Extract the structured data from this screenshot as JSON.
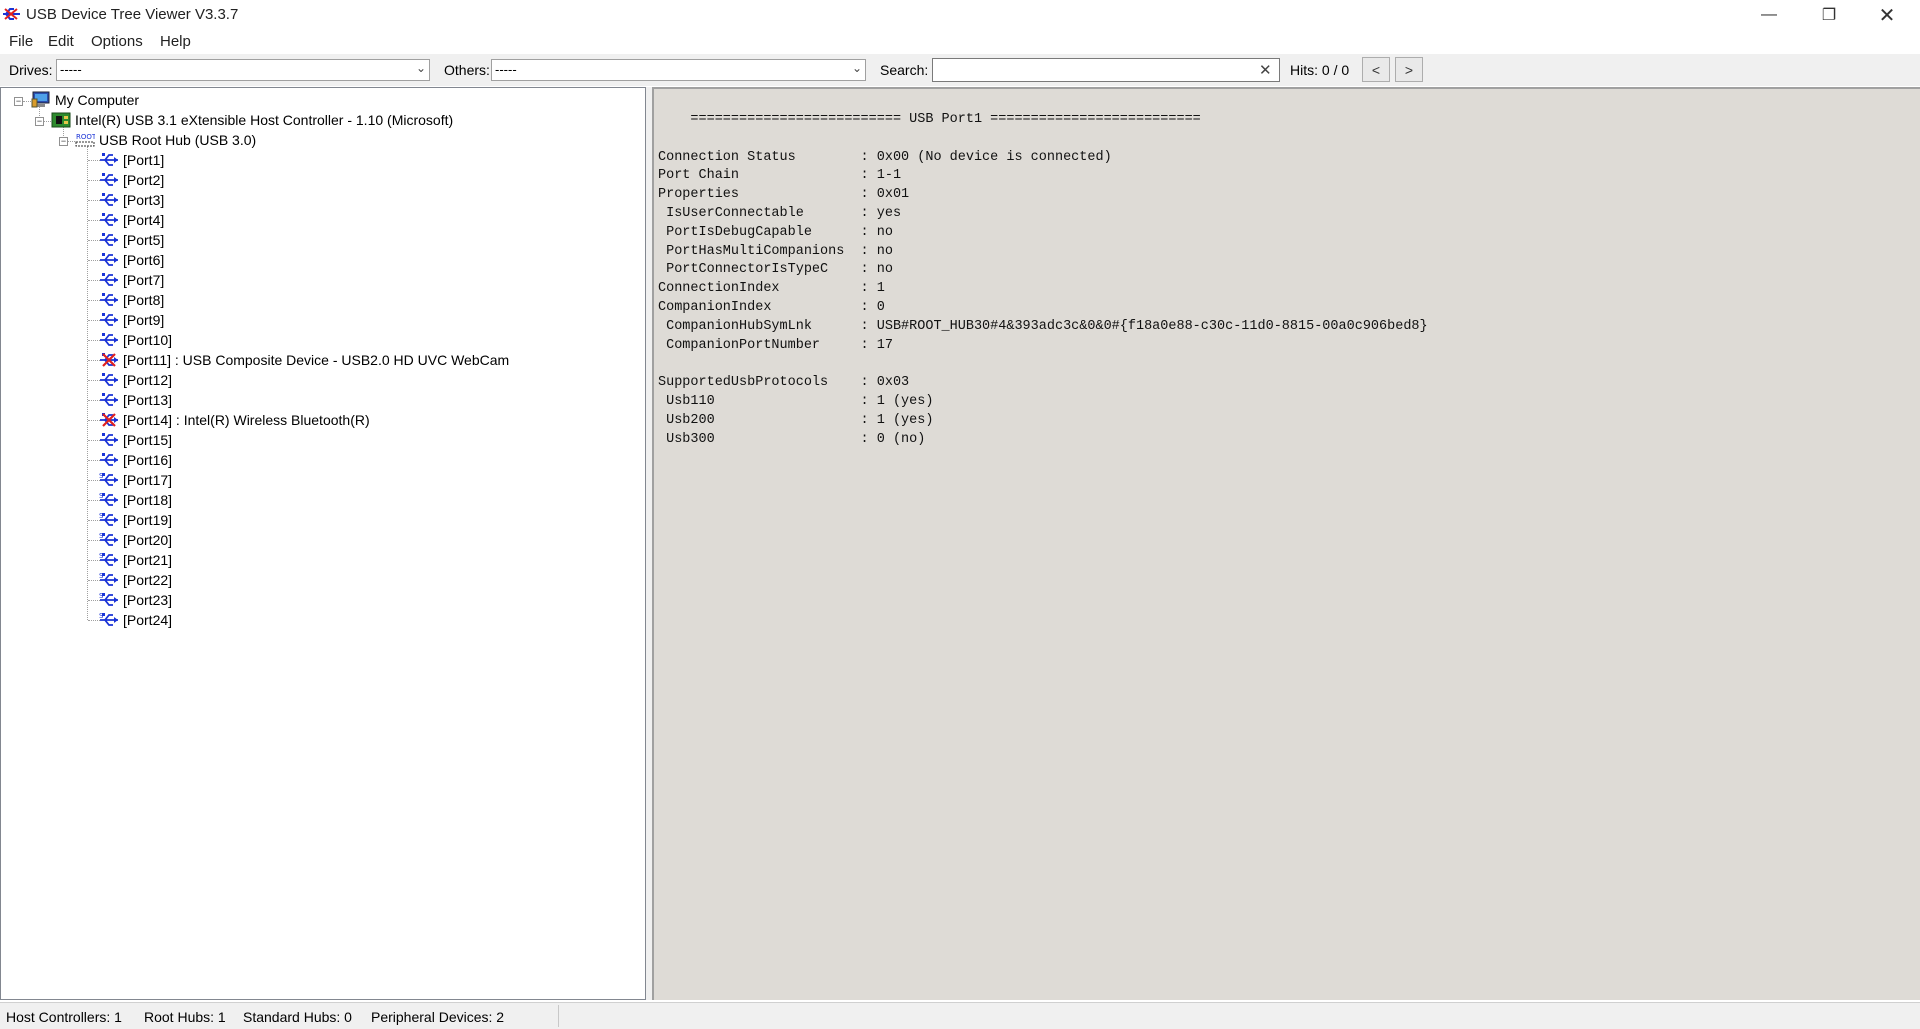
{
  "window": {
    "title": "USB Device Tree Viewer V3.3.7",
    "minimize_glyph": "—",
    "maximize_glyph": "❐",
    "close_glyph": "✕"
  },
  "menu": [
    "File",
    "Edit",
    "Options",
    "Help"
  ],
  "toolbar": {
    "drives_label": "Drives:",
    "drives_value": "-----",
    "others_label": "Others:",
    "others_value": "-----",
    "search_label": "Search:",
    "search_value": "",
    "hits_label": "Hits: 0 / 0",
    "prev_label": "<",
    "next_label": ">"
  },
  "tree": {
    "root": "My Computer",
    "controller": "Intel(R) USB 3.1 eXtensible Host Controller - 1.10 (Microsoft)",
    "hub_tag": "ROOT",
    "hub": "USB Root Hub (USB 3.0)",
    "ports": [
      {
        "label": "[Port1]",
        "status": "empty"
      },
      {
        "label": "[Port2]",
        "status": "empty"
      },
      {
        "label": "[Port3]",
        "status": "empty"
      },
      {
        "label": "[Port4]",
        "status": "empty"
      },
      {
        "label": "[Port5]",
        "status": "empty"
      },
      {
        "label": "[Port6]",
        "status": "empty"
      },
      {
        "label": "[Port7]",
        "status": "empty"
      },
      {
        "label": "[Port8]",
        "status": "empty"
      },
      {
        "label": "[Port9]",
        "status": "empty"
      },
      {
        "label": "[Port10]",
        "status": "empty"
      },
      {
        "label": "[Port11] : USB Composite Device - USB2.0 HD UVC WebCam",
        "status": "device"
      },
      {
        "label": "[Port12]",
        "status": "empty"
      },
      {
        "label": "[Port13]",
        "status": "empty"
      },
      {
        "label": "[Port14] : Intel(R) Wireless Bluetooth(R)",
        "status": "device"
      },
      {
        "label": "[Port15]",
        "status": "empty"
      },
      {
        "label": "[Port16]",
        "status": "empty"
      },
      {
        "label": "[Port17]",
        "status": "ss"
      },
      {
        "label": "[Port18]",
        "status": "ss"
      },
      {
        "label": "[Port19]",
        "status": "ss"
      },
      {
        "label": "[Port20]",
        "status": "ss"
      },
      {
        "label": "[Port21]",
        "status": "ss"
      },
      {
        "label": "[Port22]",
        "status": "ss"
      },
      {
        "label": "[Port23]",
        "status": "ss"
      },
      {
        "label": "[Port24]",
        "status": "ss"
      }
    ]
  },
  "detail": {
    "text": "    ========================== USB Port1 ==========================\n\nConnection Status        : 0x00 (No device is connected)\nPort Chain               : 1-1\nProperties               : 0x01\n IsUserConnectable       : yes\n PortIsDebugCapable      : no\n PortHasMultiCompanions  : no\n PortConnectorIsTypeC    : no\nConnectionIndex          : 1\nCompanionIndex           : 0\n CompanionHubSymLnk      : USB#ROOT_HUB30#4&393adc3c&0&0#{f18a0e88-c30c-11d0-8815-00a0c906bed8}\n CompanionPortNumber     : 17\n\nSupportedUsbProtocols    : 0x03\n Usb110                  : 1 (yes)\n Usb200                  : 1 (yes)\n Usb300                  : 0 (no)"
  },
  "status": {
    "host_controllers": "Host Controllers: 1",
    "root_hubs": "Root Hubs: 1",
    "standard_hubs": "Standard Hubs: 0",
    "peripheral_devices": "Peripheral Devices: 2"
  },
  "colors": {
    "usb_icon": "#1a33d6",
    "device_icon_mark": "#e02020",
    "detail_bg": "#dedbd6",
    "toolbar_bg": "#f0f0f0"
  }
}
